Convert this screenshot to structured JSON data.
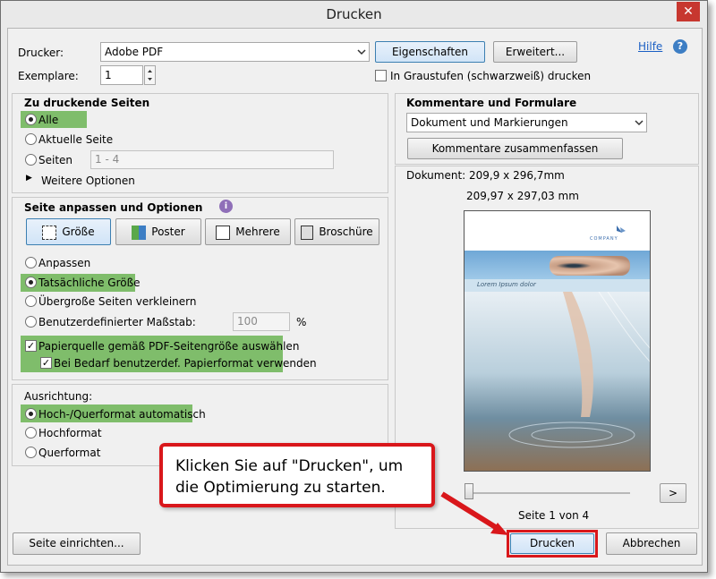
{
  "window": {
    "title": "Drucken",
    "close_glyph": "✕"
  },
  "top": {
    "printer_label": "Drucker:",
    "printer_value": "Adobe PDF",
    "properties_button": "Eigenschaften",
    "advanced_button": "Erweitert...",
    "help_link": "Hilfe",
    "copies_label": "Exemplare:",
    "copies_value": "1",
    "grayscale_label": "In Graustufen (schwarzweiß) drucken"
  },
  "pages": {
    "heading": "Zu druckende Seiten",
    "all": "Alle",
    "current": "Aktuelle Seite",
    "pages": "Seiten",
    "pages_value": "1 - 4",
    "more_options": "Weitere Optionen"
  },
  "sizing": {
    "heading": "Seite anpassen und Optionen",
    "buttons": [
      "Größe",
      "Poster",
      "Mehrere",
      "Broschüre"
    ],
    "fit": "Anpassen",
    "actual": "Tatsächliche Größe",
    "shrink": "Übergroße Seiten verkleinern",
    "custom": "Benutzerdefinierter Maßstab:",
    "custom_value": "100",
    "custom_unit": "%",
    "paper_source": "Papierquelle gemäß PDF-Seitengröße auswählen",
    "custom_paper": "Bei Bedarf benutzerdef. Papierformat verwenden"
  },
  "orientation": {
    "heading": "Ausrichtung:",
    "auto": "Hoch-/Querformat automatisch",
    "portrait": "Hochformat",
    "landscape": "Querformat"
  },
  "comments": {
    "heading": "Kommentare und Formulare",
    "select_value": "Dokument und Markierungen",
    "summarize_button": "Kommentare zusammenfassen"
  },
  "preview": {
    "document_size": "Dokument: 209,9 x 296,7mm",
    "paper_size": "209,97 x 297,03 mm",
    "doc_company": "COMPANY",
    "doc_tagline": "Lorem Ipsum dolor",
    "next_glyph": ">",
    "page_indicator": "Seite 1 von 4"
  },
  "footer": {
    "page_setup": "Seite einrichten...",
    "print": "Drucken",
    "cancel": "Abbrechen"
  },
  "callout": {
    "text": "Klicken Sie auf \"Drucken\", um die Optimierung zu starten."
  },
  "colors": {
    "highlight_green": "#7fbd6b",
    "callout_red": "#d9171b",
    "link_blue": "#1a5fc4"
  }
}
